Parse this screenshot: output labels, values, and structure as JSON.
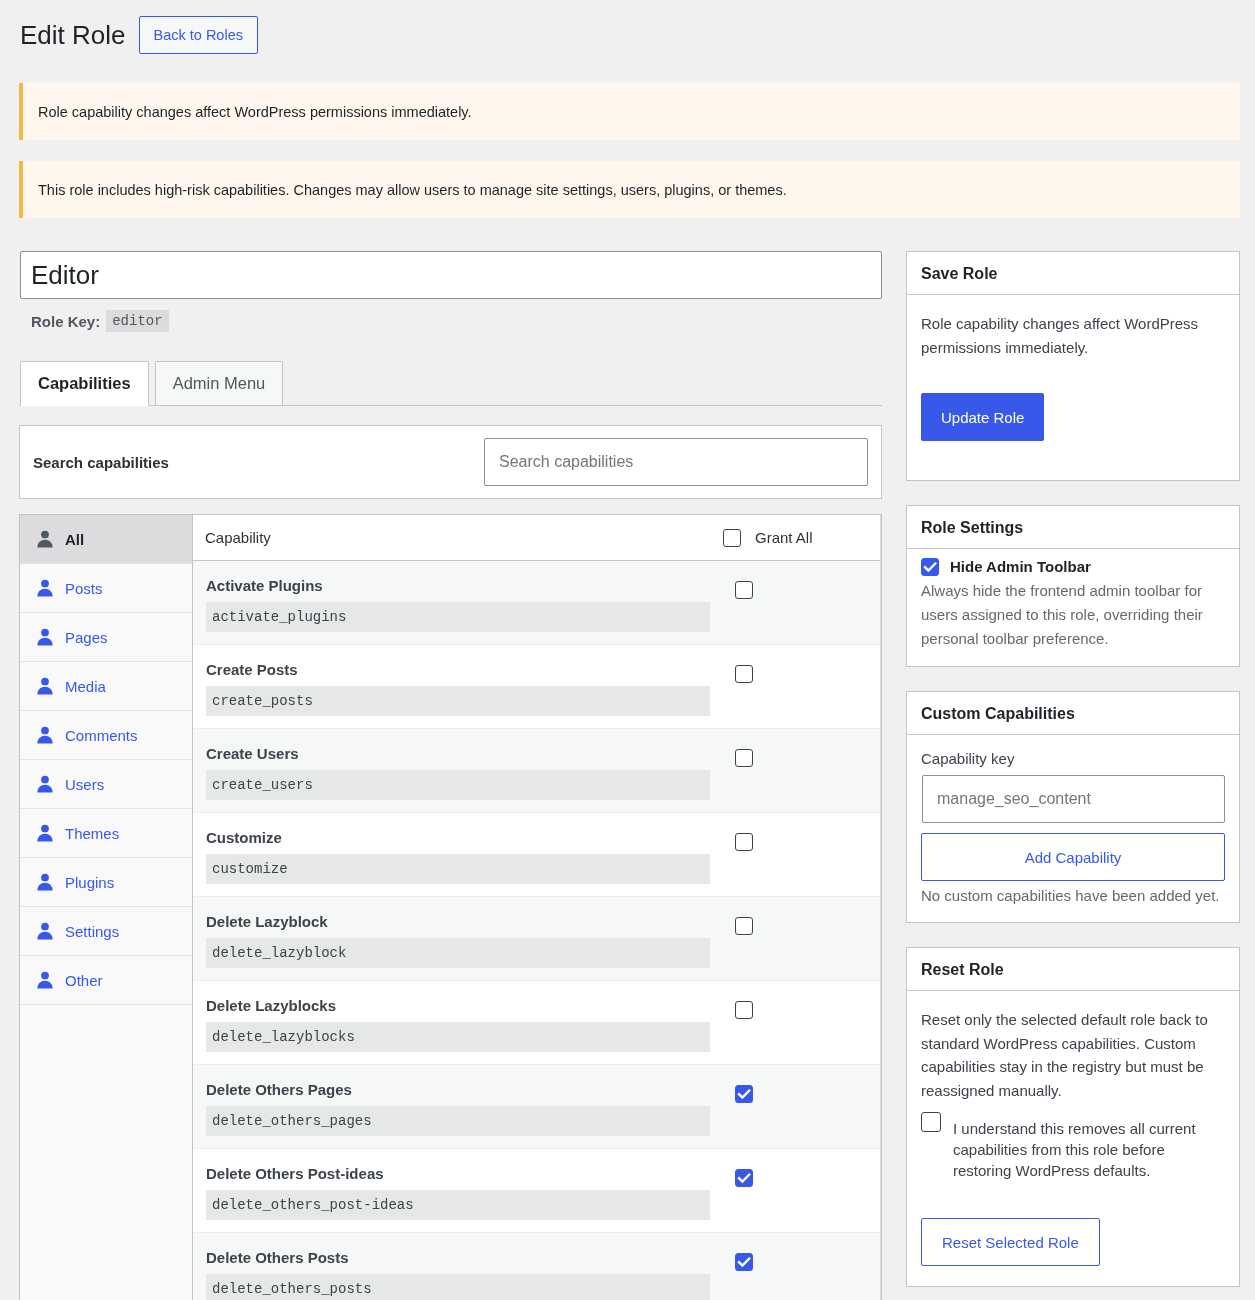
{
  "header": {
    "title": "Edit Role",
    "back_button": "Back to Roles"
  },
  "notices": [
    {
      "text": "Role capability changes affect WordPress permissions immediately."
    },
    {
      "text": "This role includes high-risk capabilities. Changes may allow users to manage site settings, users, plugins, or themes."
    }
  ],
  "role": {
    "name": "Editor",
    "key_label": "Role Key:",
    "key": "editor"
  },
  "tabs": [
    {
      "label": "Capabilities",
      "selected": true
    },
    {
      "label": "Admin Menu",
      "selected": false
    }
  ],
  "search": {
    "label": "Search capabilities",
    "placeholder": "Search capabilities"
  },
  "groups": [
    {
      "label": "All",
      "selected": true
    },
    {
      "label": "Posts",
      "selected": false
    },
    {
      "label": "Pages",
      "selected": false
    },
    {
      "label": "Media",
      "selected": false
    },
    {
      "label": "Comments",
      "selected": false
    },
    {
      "label": "Users",
      "selected": false
    },
    {
      "label": "Themes",
      "selected": false
    },
    {
      "label": "Plugins",
      "selected": false
    },
    {
      "label": "Settings",
      "selected": false
    },
    {
      "label": "Other",
      "selected": false
    }
  ],
  "table": {
    "column_header": "Capability",
    "grant_all": {
      "label": "Grant All",
      "checked": false
    },
    "rows": [
      {
        "name": "Activate Plugins",
        "key": "activate_plugins",
        "checked": false
      },
      {
        "name": "Create Posts",
        "key": "create_posts",
        "checked": false
      },
      {
        "name": "Create Users",
        "key": "create_users",
        "checked": false
      },
      {
        "name": "Customize",
        "key": "customize",
        "checked": false
      },
      {
        "name": "Delete Lazyblock",
        "key": "delete_lazyblock",
        "checked": false
      },
      {
        "name": "Delete Lazyblocks",
        "key": "delete_lazyblocks",
        "checked": false
      },
      {
        "name": "Delete Others Pages",
        "key": "delete_others_pages",
        "checked": true
      },
      {
        "name": "Delete Others Post-ideas",
        "key": "delete_others_post-ideas",
        "checked": true
      },
      {
        "name": "Delete Others Posts",
        "key": "delete_others_posts",
        "checked": true
      }
    ]
  },
  "save_role": {
    "title": "Save Role",
    "text": "Role capability changes affect WordPress permissions immediately.",
    "button": "Update Role"
  },
  "role_settings": {
    "title": "Role Settings",
    "option": {
      "label": "Hide Admin Toolbar",
      "checked": true,
      "description": "Always hide the frontend admin toolbar for users assigned to this role, overriding their personal toolbar preference."
    }
  },
  "custom_capabilities": {
    "title": "Custom Capabilities",
    "field_label": "Capability key",
    "placeholder": "manage_seo_content",
    "button": "Add Capability",
    "empty_text": "No custom capabilities have been added yet."
  },
  "reset_role": {
    "title": "Reset Role",
    "text": "Reset only the selected default role back to standard WordPress capabilities. Custom capabilities stay in the registry but must be reassigned manually.",
    "confirm": {
      "label": "I understand this removes all current capabilities from this role before restoring WordPress defaults.",
      "checked": false
    },
    "button": "Reset Selected Role"
  }
}
